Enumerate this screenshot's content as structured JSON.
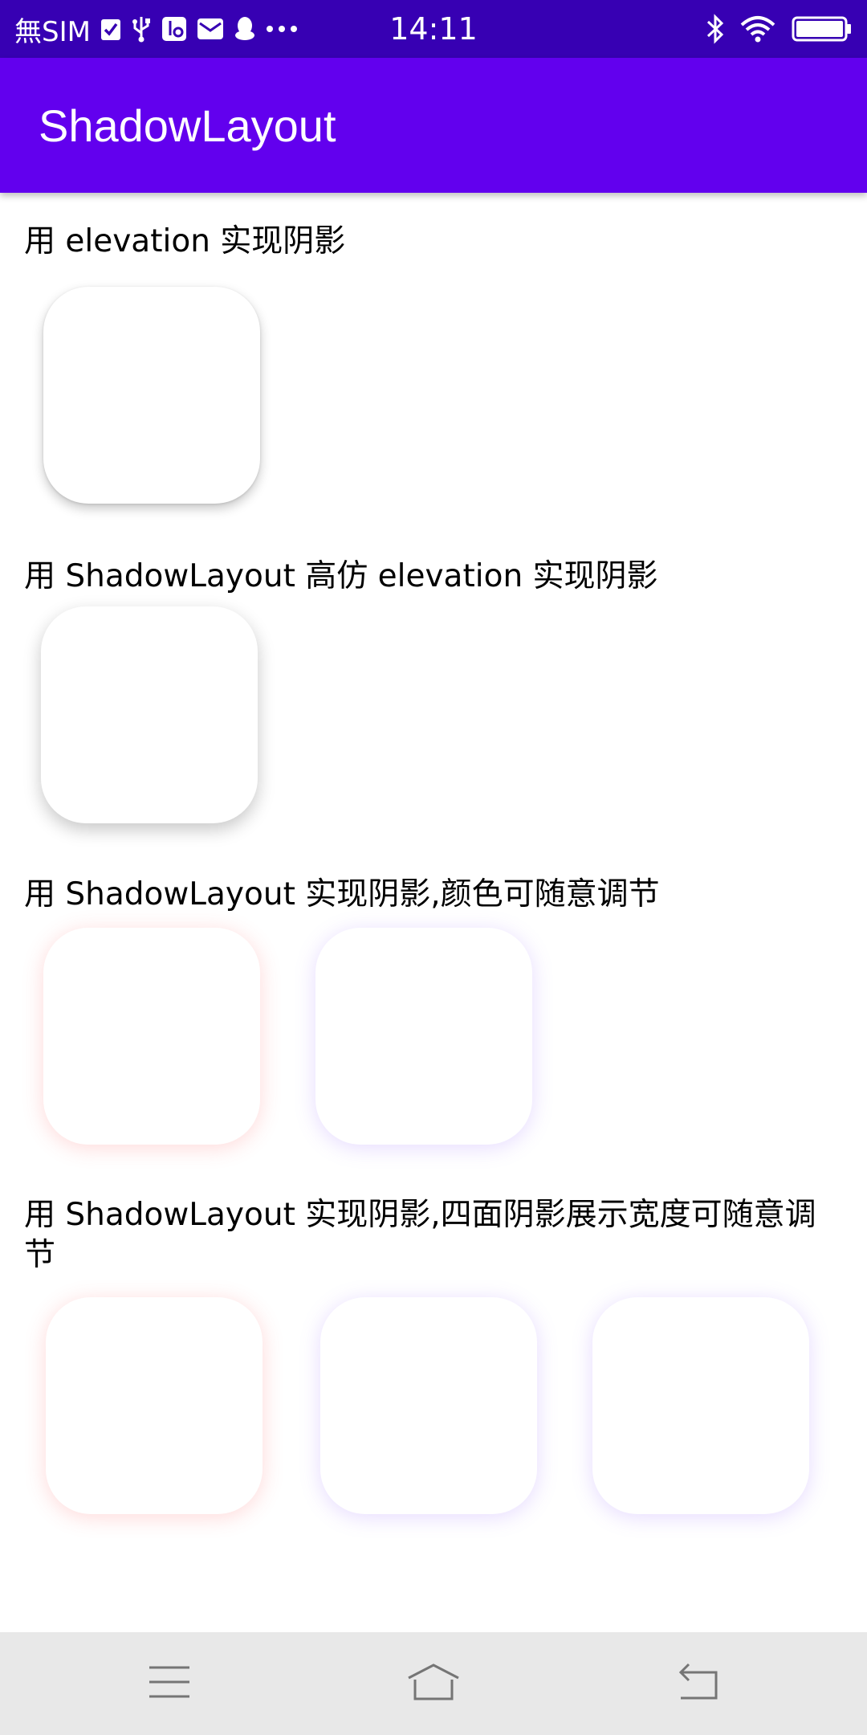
{
  "status_bar": {
    "carrier": "無SIM",
    "time": "14:11"
  },
  "app_bar": {
    "title": "ShadowLayout"
  },
  "sections": [
    {
      "label": "用 elevation 实现阴影"
    },
    {
      "label": "用 ShadowLayout 高仿 elevation 实现阴影"
    },
    {
      "label": "用 ShadowLayout 实现阴影,颜色可随意调节"
    },
    {
      "label": "用 ShadowLayout 实现阴影,四面阴影展示宽度可随意调节"
    }
  ],
  "colors": {
    "status_bar": "#3700b3",
    "app_bar": "#6200ee",
    "shadow_red": "#ff5050",
    "shadow_purple": "#8c5aff",
    "nav_bar": "#e8e8e8"
  },
  "icons": {
    "status_left": [
      "checkbox-icon",
      "usb-icon",
      "usb-settings-icon",
      "mail-icon",
      "qq-penguin-icon",
      "more-dots-icon"
    ],
    "status_right": [
      "bluetooth-icon",
      "wifi-icon",
      "battery-icon"
    ],
    "nav": [
      "menu-icon",
      "home-icon",
      "back-icon"
    ]
  }
}
